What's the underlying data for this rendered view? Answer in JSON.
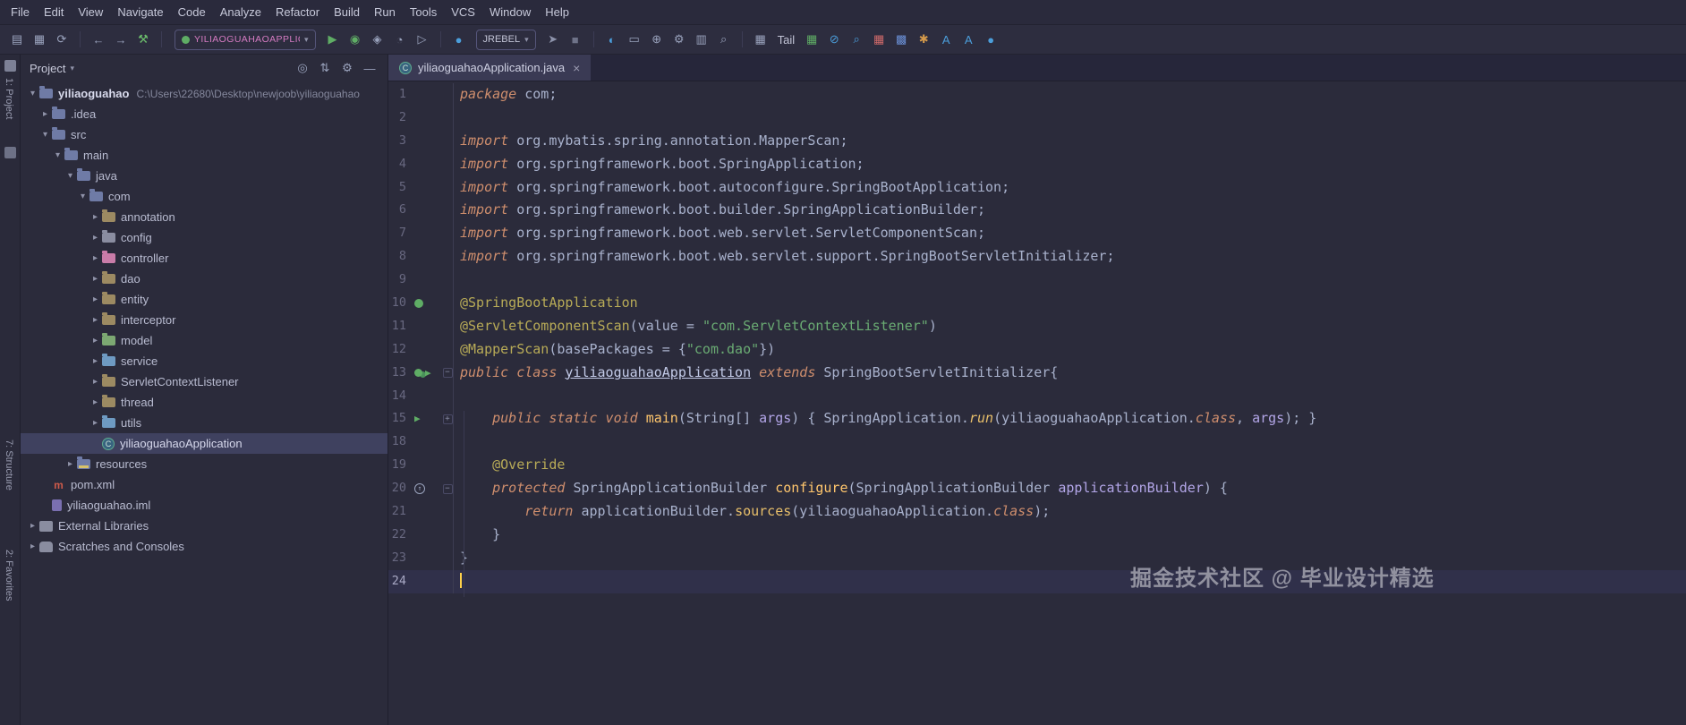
{
  "menu": {
    "items": [
      "File",
      "Edit",
      "View",
      "Navigate",
      "Code",
      "Analyze",
      "Refactor",
      "Build",
      "Run",
      "Tools",
      "VCS",
      "Window",
      "Help"
    ]
  },
  "toolbar": {
    "run_config": "yiliaoguahaoApplication",
    "jrebel": "JREBEL",
    "tail": "Tail",
    "left_icons": [
      {
        "n": "open-project-icon",
        "g": "▤",
        "c": "#9aa3bd"
      },
      {
        "n": "save-all-icon",
        "g": "▦",
        "c": "#9aa3bd"
      },
      {
        "n": "sync-icon",
        "g": "⟳",
        "c": "#9aa3bd"
      },
      {
        "sep": true
      },
      {
        "n": "back-icon",
        "g": "←",
        "c": "#9aa3bd"
      },
      {
        "n": "forward-icon",
        "g": "→",
        "c": "#9aa3bd"
      },
      {
        "n": "build-icon",
        "g": "⚒",
        "c": "#6cbf6c"
      },
      {
        "sep": true
      }
    ],
    "run_icons": [
      {
        "n": "run-icon",
        "g": "▶",
        "c": "#5fad65"
      },
      {
        "n": "debug-icon",
        "g": "◉",
        "c": "#5fad65"
      },
      {
        "n": "coverage-icon",
        "g": "◈",
        "c": "#9aa3bd"
      },
      {
        "n": "profiler-icon",
        "g": "◔",
        "c": "#9aa3bd"
      },
      {
        "n": "run-configurations-icon",
        "g": "▷",
        "c": "#9aa3bd"
      },
      {
        "sep": true
      },
      {
        "n": "jrebel-activity-icon",
        "g": "●",
        "c": "#4b9edb"
      }
    ],
    "mid_icons": [
      {
        "n": "rebel-run-icon",
        "g": "➤",
        "c": "#8d93ab"
      },
      {
        "n": "stop-icon",
        "g": "■",
        "c": "#6e7288"
      },
      {
        "sep": true
      },
      {
        "n": "browser-icon",
        "g": "◐",
        "c": "#4b9edb"
      },
      {
        "n": "terminal-icon",
        "g": "▭",
        "c": "#9aa3bd"
      },
      {
        "n": "attach-icon",
        "g": "⊕",
        "c": "#9aa3bd"
      },
      {
        "n": "settings-wrench-icon",
        "g": "⚙",
        "c": "#9aa3bd"
      },
      {
        "n": "project-structure-icon",
        "g": "▥",
        "c": "#9aa3bd"
      },
      {
        "n": "search-everywhere-icon",
        "g": "⌕",
        "c": "#9aa3bd"
      },
      {
        "sep": true
      },
      {
        "n": "database-grid-icon",
        "g": "▦",
        "c": "#9aa3bd"
      }
    ],
    "right_icons": [
      {
        "n": "green-grid-icon",
        "g": "▦",
        "c": "#5fad65"
      },
      {
        "n": "block-icon",
        "g": "⊘",
        "c": "#4b9edb"
      },
      {
        "n": "find-usages-icon",
        "g": "⌕",
        "c": "#4b9edb"
      },
      {
        "n": "red-grid-icon",
        "g": "▦",
        "c": "#cf6a6a"
      },
      {
        "n": "blue-grid-icon",
        "g": "▩",
        "c": "#6a8fd5"
      },
      {
        "n": "plugin-icon",
        "g": "✱",
        "c": "#d59a4b"
      },
      {
        "n": "translate-icon",
        "g": "A",
        "c": "#4b9edb"
      },
      {
        "n": "translate-selection-icon",
        "g": "A",
        "c": "#4b9edb"
      },
      {
        "n": "alibaba-cloud-icon",
        "g": "●",
        "c": "#4b9edb"
      }
    ]
  },
  "stripes": {
    "top": "1: Project",
    "bottom_structure": "7: Structure",
    "bottom_favorites": "2: Favorites"
  },
  "project": {
    "header_title": "Project",
    "tree": [
      {
        "label": "yiliaoguahao",
        "suffix": "C:\\Users\\22680\\Desktop\\newjoob\\yiliaoguahao",
        "level": 0,
        "state": "expanded",
        "icon": "folder-blue",
        "bold": true
      },
      {
        "label": ".idea",
        "level": 1,
        "state": "collapsed",
        "icon": "folder-blue"
      },
      {
        "label": "src",
        "level": 1,
        "state": "expanded",
        "icon": "folder-blue"
      },
      {
        "label": "main",
        "level": 2,
        "state": "expanded",
        "icon": "folder-blue"
      },
      {
        "label": "java",
        "level": 3,
        "state": "expanded",
        "icon": "folder-blue"
      },
      {
        "label": "com",
        "level": 4,
        "state": "expanded",
        "icon": "folder-blue"
      },
      {
        "label": "annotation",
        "level": 5,
        "state": "collapsed",
        "icon": "folder-tan"
      },
      {
        "label": "config",
        "level": 5,
        "state": "collapsed",
        "icon": "pkg-gray"
      },
      {
        "label": "controller",
        "level": 5,
        "state": "collapsed",
        "icon": "pkg-pink"
      },
      {
        "label": "dao",
        "level": 5,
        "state": "collapsed",
        "icon": "folder-tan"
      },
      {
        "label": "entity",
        "level": 5,
        "state": "collapsed",
        "icon": "folder-tan"
      },
      {
        "label": "interceptor",
        "level": 5,
        "state": "collapsed",
        "icon": "folder-tan"
      },
      {
        "label": "model",
        "level": 5,
        "state": "collapsed",
        "icon": "pkg-green"
      },
      {
        "label": "service",
        "level": 5,
        "state": "collapsed",
        "icon": "pkg-blue"
      },
      {
        "label": "ServletContextListener",
        "level": 5,
        "state": "collapsed",
        "icon": "folder-tan"
      },
      {
        "label": "thread",
        "level": 5,
        "state": "collapsed",
        "icon": "folder-tan"
      },
      {
        "label": "utils",
        "level": 5,
        "state": "collapsed",
        "icon": "pkg-blue"
      },
      {
        "label": "yiliaoguahaoApplication",
        "level": 5,
        "state": "none",
        "icon": "class-icon",
        "selected": true
      },
      {
        "label": "resources",
        "level": 3,
        "state": "collapsed",
        "icon": "res-icon"
      },
      {
        "label": "pom.xml",
        "level": 1,
        "state": "none",
        "icon": "maven-icon"
      },
      {
        "label": "yiliaoguahao.iml",
        "level": 1,
        "state": "none",
        "icon": "iml-icon"
      },
      {
        "label": "External Libraries",
        "level": 0,
        "state": "collapsed",
        "icon": "lib-icon"
      },
      {
        "label": "Scratches and Consoles",
        "level": 0,
        "state": "collapsed",
        "icon": "scratch-icon"
      }
    ]
  },
  "editor": {
    "tab_title": "yiliaoguahaoApplication.java",
    "lines": [
      {
        "n": "1",
        "t": [
          [
            "kw",
            "package"
          ],
          [
            "pl",
            " com;"
          ]
        ]
      },
      {
        "n": "2",
        "t": []
      },
      {
        "n": "3",
        "t": [
          [
            "kw",
            "import"
          ],
          [
            "pl",
            " org.mybatis.spring.annotation.MapperScan;"
          ]
        ]
      },
      {
        "n": "4",
        "t": [
          [
            "kw",
            "import"
          ],
          [
            "pl",
            " org.springframework.boot.SpringApplication;"
          ]
        ]
      },
      {
        "n": "5",
        "t": [
          [
            "kw",
            "import"
          ],
          [
            "pl",
            " org.springframework.boot.autoconfigure.SpringBootApplication;"
          ]
        ]
      },
      {
        "n": "6",
        "t": [
          [
            "kw",
            "import"
          ],
          [
            "pl",
            " org.springframework.boot.builder.SpringApplicationBuilder;"
          ]
        ]
      },
      {
        "n": "7",
        "t": [
          [
            "kw",
            "import"
          ],
          [
            "pl",
            " org.springframework.boot.web.servlet.ServletComponentScan;"
          ]
        ]
      },
      {
        "n": "8",
        "t": [
          [
            "kw",
            "import"
          ],
          [
            "pl",
            " org.springframework.boot.web.servlet.support.SpringBootServletInitializer;"
          ]
        ]
      },
      {
        "n": "9",
        "t": []
      },
      {
        "n": "10",
        "g": [
          "bean"
        ],
        "t": [
          [
            "ann",
            "@SpringBootApplication"
          ]
        ]
      },
      {
        "n": "11",
        "t": [
          [
            "ann",
            "@ServletComponentScan"
          ],
          [
            "pl",
            "(value = "
          ],
          [
            "str",
            "\"com.ServletContextListener\""
          ],
          [
            "pl",
            ")"
          ]
        ]
      },
      {
        "n": "12",
        "t": [
          [
            "ann",
            "@MapperScan"
          ],
          [
            "pl",
            "(basePackages = {"
          ],
          [
            "str",
            "\"com.dao\""
          ],
          [
            "pl",
            "})"
          ]
        ]
      },
      {
        "n": "13",
        "g": [
          "beans",
          "run"
        ],
        "f": "−",
        "t": [
          [
            "kw",
            "public class "
          ],
          [
            "clsu",
            "yiliaoguahaoApplication"
          ],
          [
            "kw",
            " extends "
          ],
          [
            "pl",
            "SpringBootServletInitializer{"
          ]
        ]
      },
      {
        "n": "14",
        "t": []
      },
      {
        "n": "15",
        "g": [
          "run"
        ],
        "f": "+",
        "t": [
          [
            "pl",
            "    "
          ],
          [
            "kw",
            "public static void "
          ],
          [
            "fn",
            "main"
          ],
          [
            "pl",
            "(String[] "
          ],
          [
            "prm",
            "args"
          ],
          [
            "pl",
            ") { SpringApplication."
          ],
          [
            "mi",
            "run"
          ],
          [
            "pl",
            "(yiliaoguahaoApplication."
          ],
          [
            "kw",
            "class"
          ],
          [
            "pl",
            ", "
          ],
          [
            "prm",
            "args"
          ],
          [
            "pl",
            "); }"
          ]
        ]
      },
      {
        "n": "18",
        "t": []
      },
      {
        "n": "19",
        "t": [
          [
            "pl",
            "    "
          ],
          [
            "ann",
            "@Override"
          ]
        ]
      },
      {
        "n": "20",
        "g": [
          "override"
        ],
        "f": "−",
        "t": [
          [
            "pl",
            "    "
          ],
          [
            "kw",
            "protected "
          ],
          [
            "pl",
            "SpringApplicationBuilder "
          ],
          [
            "fn",
            "configure"
          ],
          [
            "pl",
            "(SpringApplicationBuilder "
          ],
          [
            "prm",
            "applicationBuilder"
          ],
          [
            "pl",
            ") {"
          ]
        ]
      },
      {
        "n": "21",
        "t": [
          [
            "pl",
            "        "
          ],
          [
            "kw",
            "return "
          ],
          [
            "pl",
            "applicationBuilder."
          ],
          [
            "mc",
            "sources"
          ],
          [
            "pl",
            "(yiliaoguahaoApplication."
          ],
          [
            "kw",
            "class"
          ],
          [
            "pl",
            ");"
          ]
        ]
      },
      {
        "n": "22",
        "t": [
          [
            "pl",
            "    }"
          ]
        ]
      },
      {
        "n": "23",
        "t": [
          [
            "pl",
            "}"
          ]
        ]
      },
      {
        "n": "24",
        "current": true,
        "caret": true,
        "t": []
      }
    ]
  },
  "watermark": "掘金技术社区 @ 毕业设计精选"
}
